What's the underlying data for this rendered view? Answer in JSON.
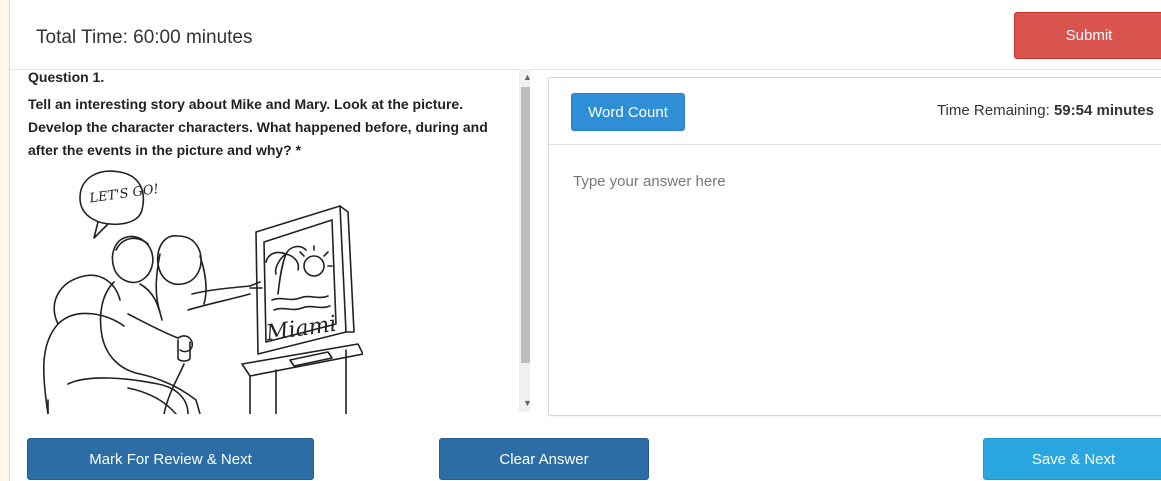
{
  "header": {
    "total_time": "Total Time: 60:00 minutes",
    "submit_label": "Submit"
  },
  "question": {
    "number": "Question 1.",
    "text": "Tell an interesting story about Mike and Mary. Look at the picture. Develop the character characters. What happened before, during and after the events in the picture and why? *",
    "image": {
      "speech_bubble": "LET'S GO!",
      "screen_text": "Miami"
    }
  },
  "answer": {
    "word_count_label": "Word Count",
    "time_remaining_label": "Time Remaining:",
    "time_remaining_value": "59:54 minutes",
    "placeholder": "Type your answer here"
  },
  "footer": {
    "mark_review_label": "Mark For Review & Next",
    "clear_label": "Clear Answer",
    "save_next_label": "Save & Next"
  },
  "colors": {
    "submit": "#d9534f",
    "primary_dark": "#2b6da4",
    "primary_light": "#29a6e0",
    "word_count": "#2e8fd6"
  }
}
